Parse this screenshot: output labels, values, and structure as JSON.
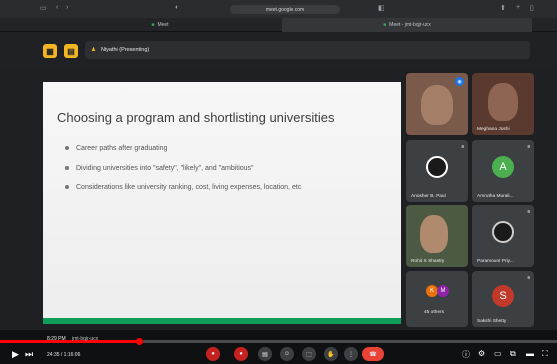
{
  "browser": {
    "url": "meet.google.com",
    "tabs": [
      "Meet",
      "Meet - jmt-bqjr-ucx"
    ]
  },
  "header": {
    "presenter": "Niyathi (Presenting)"
  },
  "slide": {
    "title": "Choosing a program and shortlisting universities",
    "bullets": [
      "Career paths after graduating",
      "Dividing universities into \"safety\", \"likely\", and \"ambitious\"",
      "Considerations like university ranking, cost, living expenses, location, etc"
    ]
  },
  "participants": [
    {
      "name": "",
      "avatar": "",
      "color": "#8a6b5a"
    },
    {
      "name": "Meghana Joshi",
      "avatar": "",
      "color": "#6b4a3a"
    },
    {
      "name": "Anosher B. Paul",
      "avatar": "",
      "color": "#2a2a2a"
    },
    {
      "name": "Amrutha Murali...",
      "avatar": "A",
      "color": "#4caf50"
    },
    {
      "name": "Rohit S Shastry",
      "avatar": "",
      "color": "#5a6a4a"
    },
    {
      "name": "Paramount Priy...",
      "avatar": "",
      "color": "#2a2a2a"
    },
    {
      "name": "45 others",
      "avatar": "",
      "color": ""
    },
    {
      "name": "Sakshi Shetty",
      "avatar": "S",
      "color": "#c0392b"
    }
  ],
  "others_badges": [
    "K",
    "M"
  ],
  "bottom": {
    "meeting_time": "8:29 PM",
    "meeting_code": "jmt-bqjr-ucx",
    "video_time": "24:35 / 1:16:06",
    "progress": 0.25
  },
  "colors": {
    "accent": "#f2b624",
    "end_call": "#ea4335",
    "progress": "#ff0000",
    "slide_bar": "#0f9d58"
  }
}
